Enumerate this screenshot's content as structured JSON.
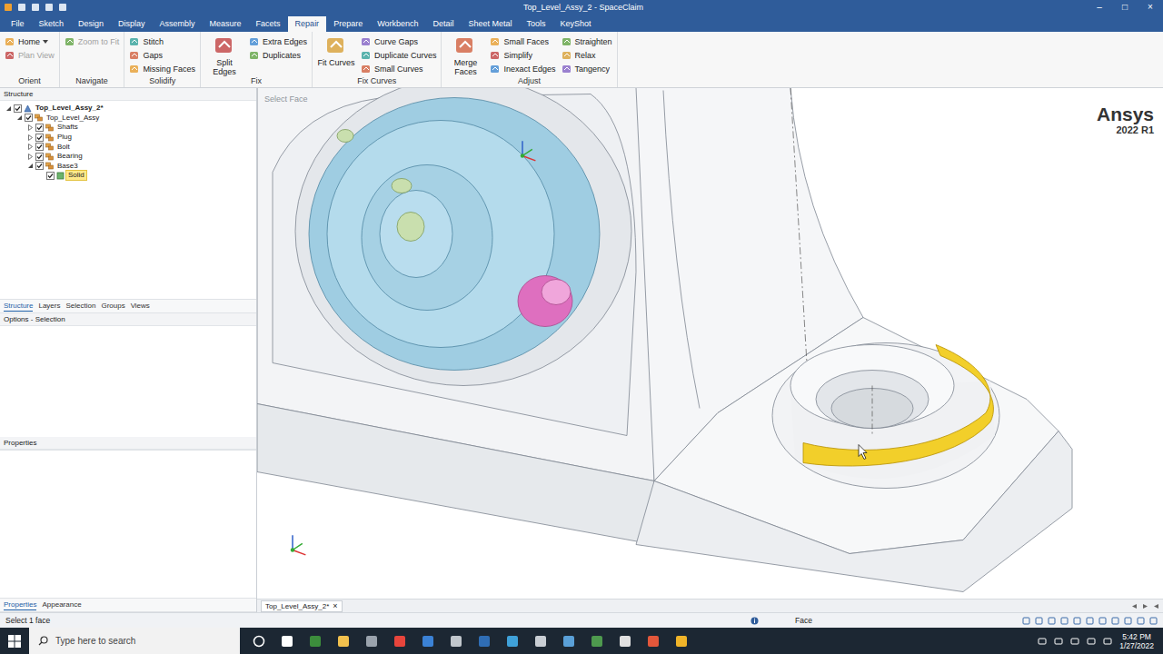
{
  "window": {
    "title": "Top_Level_Assy_2 - SpaceClaim",
    "controls": [
      "–",
      "□",
      "×"
    ]
  },
  "ribbon": {
    "tabs": [
      {
        "label": "File",
        "selected": false
      },
      {
        "label": "Sketch",
        "selected": false
      },
      {
        "label": "Design",
        "selected": false
      },
      {
        "label": "Display",
        "selected": false
      },
      {
        "label": "Assembly",
        "selected": false
      },
      {
        "label": "Measure",
        "selected": false
      },
      {
        "label": "Facets",
        "selected": false
      },
      {
        "label": "Repair",
        "selected": true
      },
      {
        "label": "Prepare",
        "selected": false
      },
      {
        "label": "Workbench",
        "selected": false
      },
      {
        "label": "Detail",
        "selected": false
      },
      {
        "label": "Sheet Metal",
        "selected": false
      },
      {
        "label": "Tools",
        "selected": false
      },
      {
        "label": "KeyShot",
        "selected": false
      }
    ],
    "groups": [
      {
        "label": "Orient",
        "buttons": [
          {
            "label": "Home",
            "kind": "split",
            "disabled": false
          },
          {
            "label": "Plan View",
            "kind": "small",
            "disabled": true
          }
        ]
      },
      {
        "label": "Navigate",
        "buttons": [
          {
            "label": "Zoom to Fit",
            "kind": "small",
            "disabled": true
          }
        ]
      },
      {
        "label": "Solidify",
        "buttons": [
          {
            "label": "Stitch",
            "kind": "small",
            "disabled": false
          },
          {
            "label": "Gaps",
            "kind": "small",
            "disabled": false
          },
          {
            "label": "Missing Faces",
            "kind": "small",
            "disabled": false
          }
        ]
      },
      {
        "label": "Fix",
        "buttons": [
          {
            "label": "Split Edges",
            "kind": "large",
            "disabled": false
          },
          {
            "label": "Extra Edges",
            "kind": "small",
            "disabled": false
          },
          {
            "label": "Duplicates",
            "kind": "small",
            "disabled": false
          }
        ]
      },
      {
        "label": "Fix Curves",
        "buttons": [
          {
            "label": "Fit Curves",
            "kind": "large",
            "disabled": false
          },
          {
            "label": "Curve Gaps",
            "kind": "small",
            "disabled": false
          },
          {
            "label": "Duplicate Curves",
            "kind": "small",
            "disabled": false
          },
          {
            "label": "Small Curves",
            "kind": "small",
            "disabled": false
          }
        ]
      },
      {
        "label": "Adjust",
        "buttons": [
          {
            "label": "Merge Faces",
            "kind": "large",
            "disabled": false
          },
          {
            "label": "Small Faces",
            "kind": "small",
            "disabled": false
          },
          {
            "label": "Simplify",
            "kind": "small",
            "disabled": false
          },
          {
            "label": "Inexact Edges",
            "kind": "small",
            "disabled": false
          },
          {
            "label": "Straighten",
            "kind": "small",
            "disabled": false
          },
          {
            "label": "Relax",
            "kind": "small",
            "disabled": false
          },
          {
            "label": "Tangency",
            "kind": "small",
            "disabled": false
          }
        ]
      }
    ]
  },
  "structure": {
    "title": "Structure",
    "tree": [
      {
        "label": "Top_Level_Assy_2*",
        "kind": "document",
        "expandable": true,
        "expanded": true,
        "checked": true,
        "selected": false,
        "children": [
          {
            "label": "Top_Level_Assy",
            "kind": "assembly",
            "expandable": true,
            "expanded": true,
            "checked": true,
            "selected": false,
            "children": [
              {
                "label": "Shafts",
                "kind": "component",
                "expandable": true,
                "expanded": false,
                "checked": true,
                "selected": false,
                "children": []
              },
              {
                "label": "Plug",
                "kind": "component",
                "expandable": true,
                "expanded": false,
                "checked": true,
                "selected": false,
                "children": []
              },
              {
                "label": "Bolt",
                "kind": "component",
                "expandable": true,
                "expanded": false,
                "checked": true,
                "selected": false,
                "children": []
              },
              {
                "label": "Bearing",
                "kind": "component",
                "expandable": true,
                "expanded": false,
                "checked": true,
                "selected": false,
                "children": []
              },
              {
                "label": "Base3",
                "kind": "component",
                "expandable": true,
                "expanded": true,
                "checked": true,
                "selected": false,
                "children": [
                  {
                    "label": "Solid",
                    "kind": "body",
                    "expandable": false,
                    "expanded": false,
                    "checked": true,
                    "selected": true,
                    "children": []
                  }
                ]
              }
            ]
          }
        ]
      }
    ]
  },
  "panel_tabs": [
    {
      "label": "Structure",
      "selected": true
    },
    {
      "label": "Layers",
      "selected": false
    },
    {
      "label": "Selection",
      "selected": false
    },
    {
      "label": "Groups",
      "selected": false
    },
    {
      "label": "Views",
      "selected": false
    }
  ],
  "options": {
    "title": "Options - Selection"
  },
  "properties": {
    "title": "Properties"
  },
  "bottom_tabs": [
    {
      "label": "Properties",
      "selected": true
    },
    {
      "label": "Appearance",
      "selected": false
    }
  ],
  "viewport": {
    "hint": "Select Face",
    "brand": "Ansys",
    "version": "2022 R1",
    "face_selected": true,
    "tab": {
      "label": "Top_Level_Assy_2*",
      "close": "×",
      "selected": true
    }
  },
  "status_bar": {
    "message": "Select 1 face",
    "mode": "Face"
  },
  "taskbar": {
    "search_placeholder": "Type here to search",
    "time": "5:42 PM",
    "date": "1/27/2022"
  }
}
